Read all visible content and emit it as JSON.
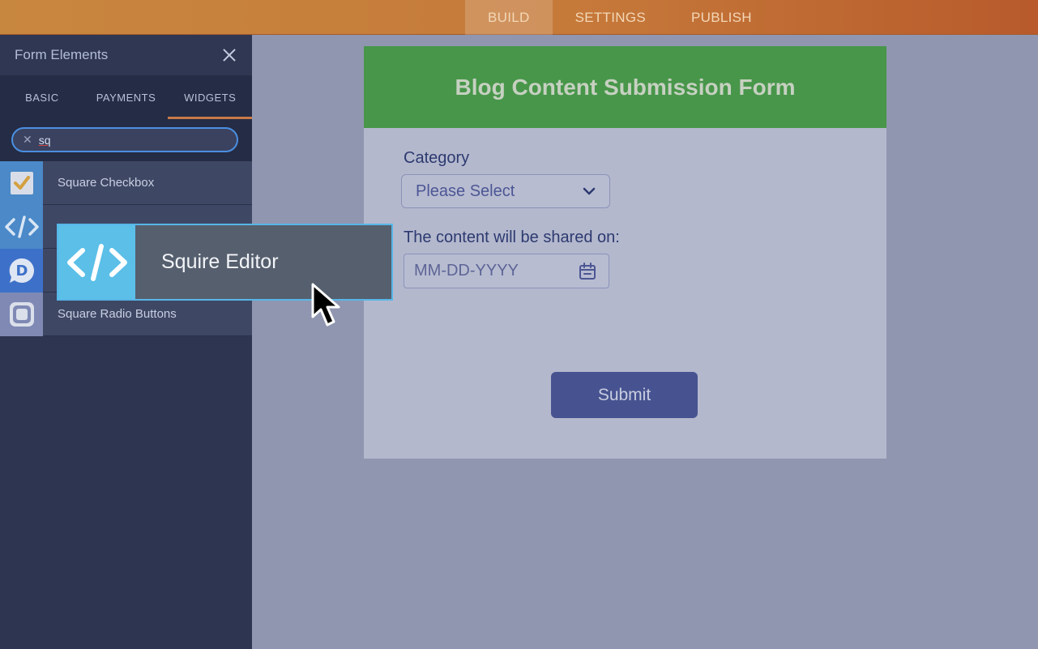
{
  "topbar": {
    "tabs": [
      {
        "label": "BUILD",
        "active": true
      },
      {
        "label": "SETTINGS",
        "active": false
      },
      {
        "label": "PUBLISH",
        "active": false
      }
    ]
  },
  "sidebar": {
    "title": "Form Elements",
    "tabs": [
      {
        "label": "BASIC"
      },
      {
        "label": "PAYMENTS"
      },
      {
        "label": "WIDGETS",
        "active": true
      }
    ],
    "search": {
      "value": "sq"
    },
    "items": [
      {
        "label": "Square Checkbox",
        "icon": "checkbox-icon"
      },
      {
        "label": "",
        "icon": "code-icon"
      },
      {
        "label": "",
        "icon": "disqus-icon"
      },
      {
        "label": "Square Radio Buttons",
        "icon": "radio-square-icon"
      }
    ]
  },
  "drag": {
    "label": "Squire Editor",
    "icon": "code-icon"
  },
  "form": {
    "title": "Blog Content Submission Form",
    "category_label": "Category",
    "category_value": "Please Select",
    "date_label": "The content will be shared on:",
    "date_placeholder": "MM-DD-YYYY",
    "submit_label": "Submit"
  },
  "colors": {
    "topbar": "#c67a3a",
    "sidebar": "#2d3550",
    "form_header": "#48964a",
    "submit": "#475390",
    "accent": "#57b6e8"
  }
}
